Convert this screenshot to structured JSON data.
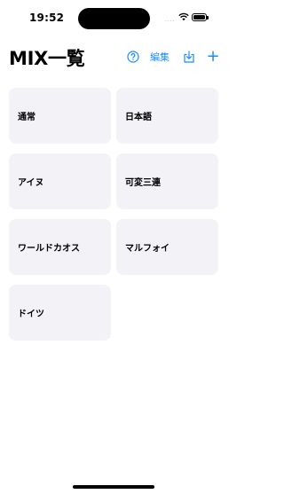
{
  "status": {
    "time": "19:52",
    "cell_signal": "....",
    "wifi_icon": "wifi-icon",
    "battery_icon": "battery-icon"
  },
  "header": {
    "title": "MIX一覧",
    "edit_label": "編集",
    "add_label": "+",
    "help_icon": "question-circle-icon",
    "share_icon": "download-tray-icon",
    "accent_color": "#1a8cff"
  },
  "mixes": [
    {
      "label": "通常"
    },
    {
      "label": "日本語"
    },
    {
      "label": "アイヌ"
    },
    {
      "label": "可変三連"
    },
    {
      "label": "ワールドカオス"
    },
    {
      "label": "マルフォイ"
    },
    {
      "label": "ドイツ"
    }
  ]
}
